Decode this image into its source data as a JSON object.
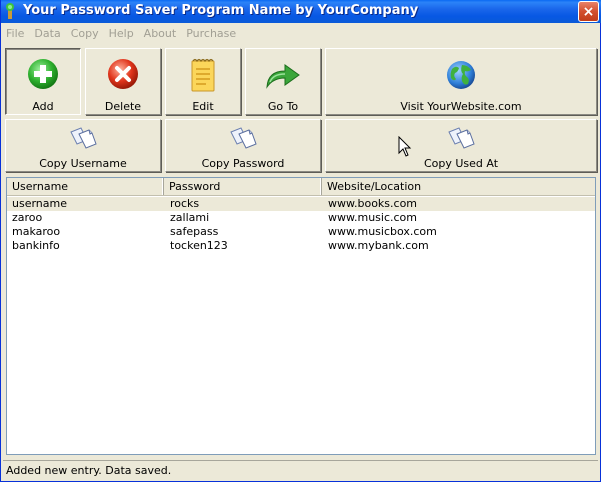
{
  "window": {
    "title": "Your Password Saver Program Name by YourCompany",
    "close_label": "×"
  },
  "menu": [
    "File",
    "Data",
    "Copy",
    "Help",
    "About",
    "Purchase"
  ],
  "toolbar": {
    "add": "Add",
    "delete": "Delete",
    "edit": "Edit",
    "goto": "Go To",
    "visit": "Visit YourWebsite.com",
    "copy_username": "Copy Username",
    "copy_password": "Copy Password",
    "copy_used_at": "Copy Used At"
  },
  "list": {
    "columns": [
      "Username",
      "Password",
      "Website/Location"
    ],
    "rows": [
      {
        "username": "username",
        "password": "rocks",
        "website": "www.books.com",
        "selected": true
      },
      {
        "username": "zaroo",
        "password": "zallami",
        "website": "www.music.com",
        "selected": false
      },
      {
        "username": "makaroo",
        "password": "safepass",
        "website": "www.musicbox.com",
        "selected": false
      },
      {
        "username": "bankinfo",
        "password": "tocken123",
        "website": "www.mybank.com",
        "selected": false
      }
    ]
  },
  "status": {
    "text": "Added new entry.  Data saved."
  },
  "icons": {
    "add": "plus-circle-icon",
    "delete": "x-circle-icon",
    "edit": "notepad-icon",
    "goto": "arrow-right-icon",
    "visit": "globe-icon",
    "copy": "copy-documents-icon"
  },
  "colors": {
    "titlebar": "#0758e4",
    "window_bg": "#ece9d8",
    "add_green": "#2fb12f",
    "delete_red": "#e0341b",
    "selected_row": "#ece9d8"
  }
}
